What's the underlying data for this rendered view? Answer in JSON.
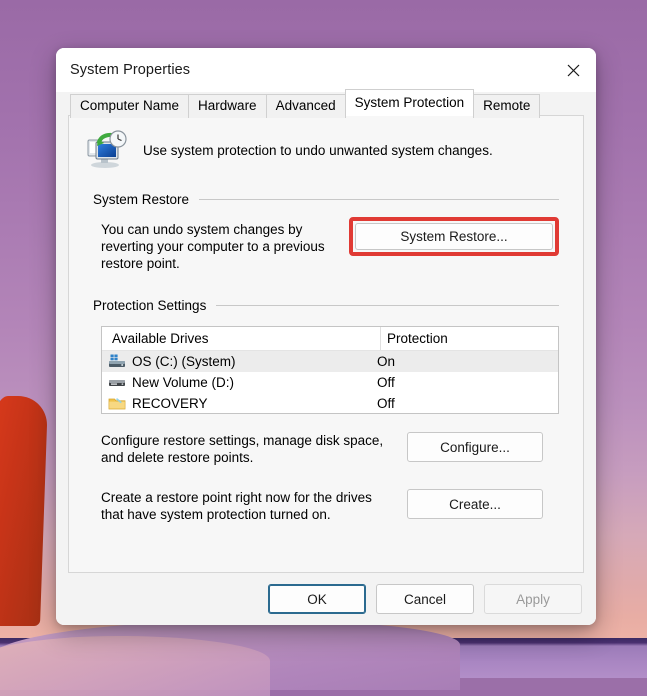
{
  "window": {
    "title": "System Properties",
    "close_icon": "close-icon"
  },
  "tabs": [
    {
      "label": "Computer Name",
      "active": false
    },
    {
      "label": "Hardware",
      "active": false
    },
    {
      "label": "Advanced",
      "active": false
    },
    {
      "label": "System Protection",
      "active": true
    },
    {
      "label": "Remote",
      "active": false
    }
  ],
  "intro": {
    "icon": "system-protection-icon",
    "text": "Use system protection to undo unwanted system changes."
  },
  "system_restore": {
    "group_label": "System Restore",
    "description": "You can undo system changes by reverting your computer to a previous restore point.",
    "button_label": "System Restore...",
    "highlight_color": "#e03a34"
  },
  "protection_settings": {
    "group_label": "Protection Settings",
    "columns": [
      "Available Drives",
      "Protection"
    ],
    "rows": [
      {
        "icon": "system-drive-icon",
        "drive": "OS (C:) (System)",
        "protection": "On",
        "selected": true
      },
      {
        "icon": "hard-drive-icon",
        "drive": "New Volume (D:)",
        "protection": "Off",
        "selected": false
      },
      {
        "icon": "folder-icon",
        "drive": "RECOVERY",
        "protection": "Off",
        "selected": false
      }
    ],
    "configure": {
      "description": "Configure restore settings, manage disk space, and delete restore points.",
      "button_label": "Configure..."
    },
    "create": {
      "description": "Create a restore point right now for the drives that have system protection turned on.",
      "button_label": "Create..."
    }
  },
  "footer": {
    "ok_label": "OK",
    "cancel_label": "Cancel",
    "apply_label": "Apply"
  }
}
